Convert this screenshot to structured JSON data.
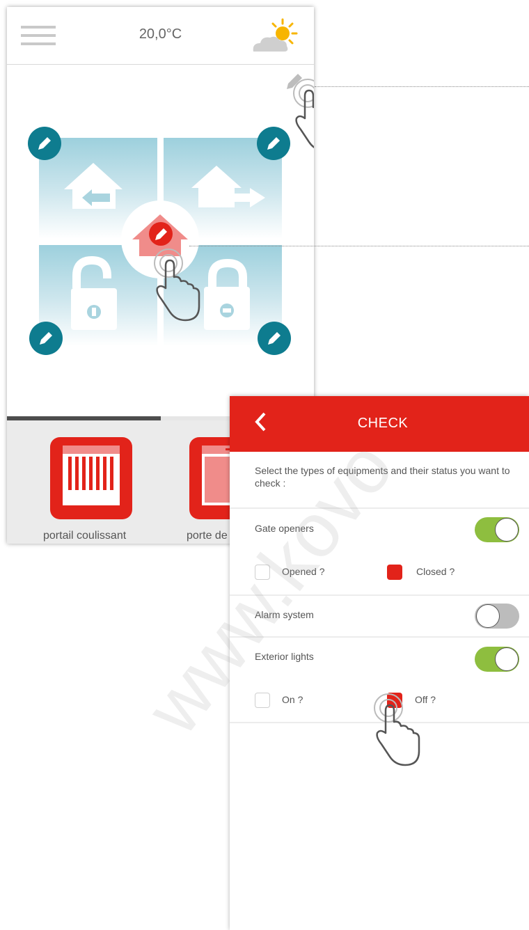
{
  "screen1": {
    "temperature": "20,0°C",
    "devices": [
      {
        "label": "portail coulissant"
      },
      {
        "label": "porte de"
      }
    ]
  },
  "screen2": {
    "title": "CHECK",
    "intro": "Select the types of equipments and their status you want to check :",
    "rows": [
      {
        "label": "Gate openers",
        "toggle": "on",
        "options": [
          {
            "label": "Opened ?",
            "checked": false
          },
          {
            "label": "Closed ?",
            "checked": true
          }
        ]
      },
      {
        "label": "Alarm system",
        "toggle": "off"
      },
      {
        "label": "Exterior lights",
        "toggle": "on",
        "options": [
          {
            "label": "On ?",
            "checked": false
          },
          {
            "label": "Off ?",
            "checked": true
          }
        ]
      }
    ]
  },
  "watermark": "www.kovo",
  "colors": {
    "accent_red": "#e2231a",
    "edit_teal": "#0e7c8f",
    "toggle_green": "#8ebe3f",
    "tile_blue": "#9dd0dd"
  }
}
